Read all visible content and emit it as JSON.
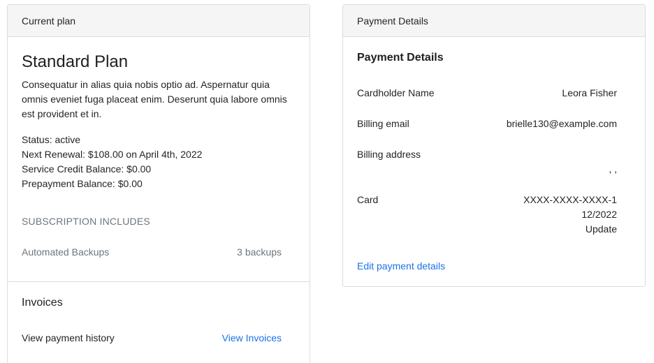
{
  "current_plan": {
    "header": "Current plan",
    "title": "Standard Plan",
    "description": "Consequatur in alias quia nobis optio ad. Aspernatur quia omnis eveniet fuga placeat enim. Deserunt quia labore omnis est provident et in.",
    "status": "Status: active",
    "next_renewal": "Next Renewal: $108.00 on April 4th, 2022",
    "service_credit": "Service Credit Balance: $0.00",
    "prepayment": "Prepayment Balance: $0.00",
    "subscription_heading": "SUBSCRIPTION INCLUDES",
    "subscription_items": [
      {
        "name": "Automated Backups",
        "value": "3 backups"
      }
    ]
  },
  "invoices": {
    "title": "Invoices",
    "label": "View payment history",
    "link": "View Invoices"
  },
  "payment_details": {
    "header": "Payment Details",
    "title": "Payment Details",
    "cardholder_label": "Cardholder Name",
    "cardholder_value": "Leora Fisher",
    "email_label": "Billing email",
    "email_value": "brielle130@example.com",
    "address_label": "Billing address",
    "address_value": ", ,",
    "card_label": "Card",
    "card_number": "XXXX-XXXX-XXXX-1",
    "card_expiry": "12/2022",
    "card_update": "Update",
    "edit_link": "Edit payment details"
  },
  "colors": {
    "link": "#1a73e8",
    "muted": "#6c757d",
    "header_bg": "#f5f5f5",
    "border": "#dcdcdc"
  }
}
